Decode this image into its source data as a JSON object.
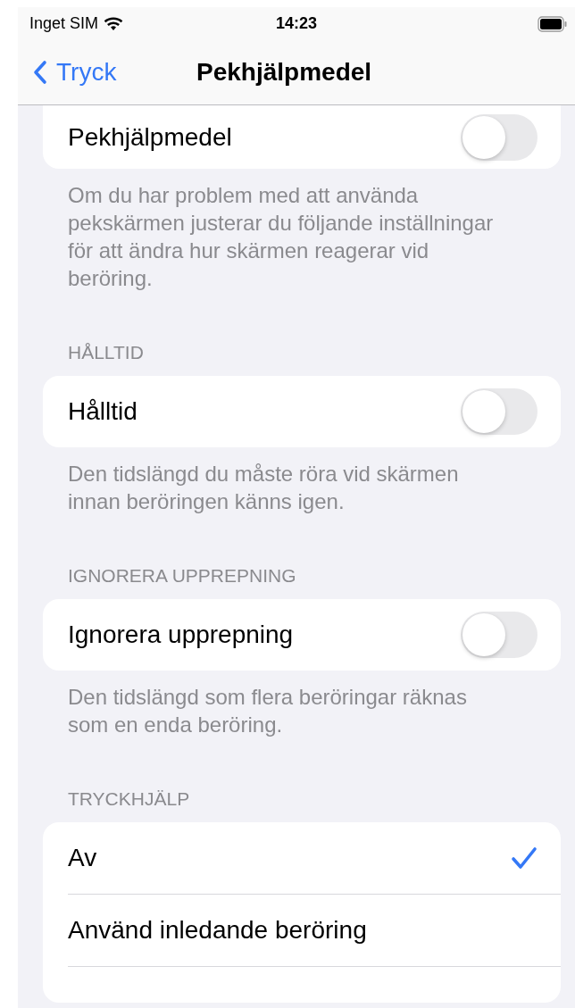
{
  "status_bar": {
    "carrier": "Inget SIM",
    "time": "14:23"
  },
  "nav": {
    "back": "Tryck",
    "title": "Pekhjälpmedel"
  },
  "sections": [
    {
      "kind": "toggle",
      "rows": [
        {
          "label": "Pekhjälpmedel",
          "on": false
        }
      ],
      "footer": "Om du har problem med att använda pekskärmen justerar du följande inställningar för att ändra hur skärmen reagerar vid beröring."
    },
    {
      "kind": "toggle",
      "header": "HÅLLTID",
      "rows": [
        {
          "label": "Hålltid",
          "on": false
        }
      ],
      "footer": "Den tidslängd du måste röra vid skärmen innan beröringen känns igen."
    },
    {
      "kind": "toggle",
      "header": "IGNORERA UPPREPNING",
      "rows": [
        {
          "label": "Ignorera upprepning",
          "on": false
        }
      ],
      "footer": "Den tidslängd som flera beröringar räknas som en enda beröring."
    },
    {
      "kind": "choice",
      "header": "TRYCKHJÄLP",
      "rows": [
        {
          "label": "Av",
          "selected": true
        },
        {
          "label": "Använd inledande beröring",
          "selected": false
        }
      ]
    }
  ]
}
